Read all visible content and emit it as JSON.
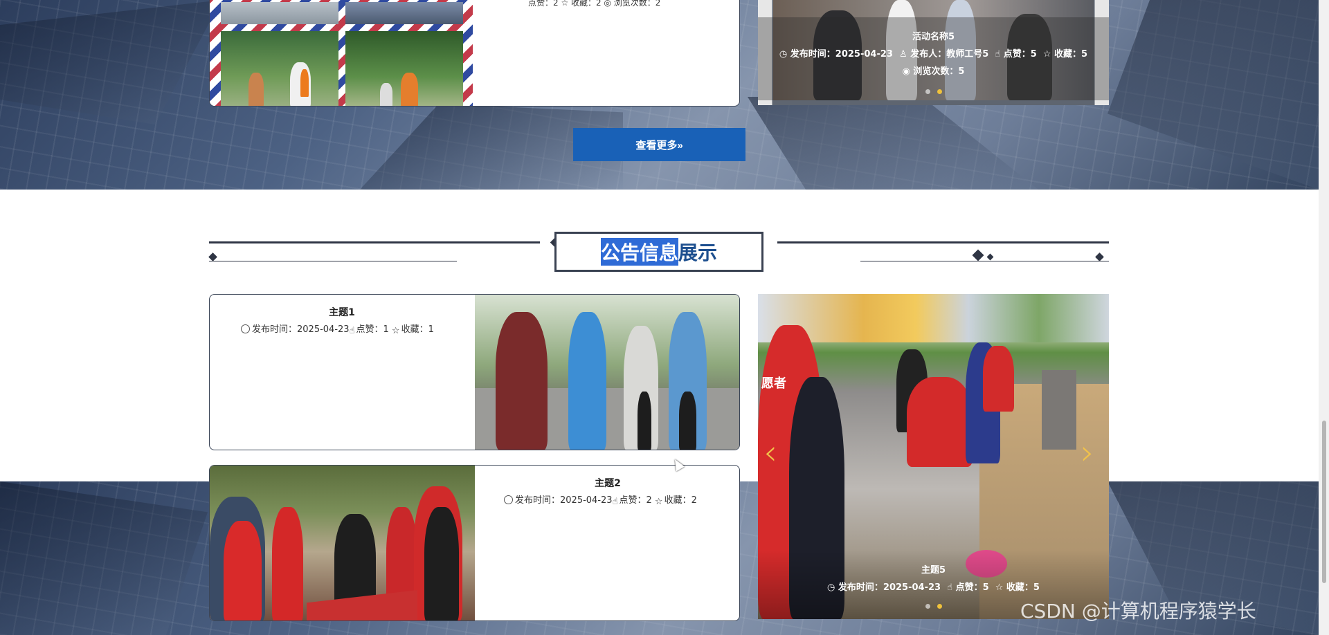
{
  "activity_section": {
    "card_top_meta_partial": "点赞：2 ☆ 收藏：2 ◎ 浏览次数：2",
    "carousel": {
      "title": "活动名称5",
      "meta_line1": "发布时间：2025-04-23",
      "publisher": "发布人：教师工号5",
      "likes": "点赞：5",
      "favorites": "收藏：5",
      "views": "浏览次数：5"
    },
    "more_button": "查看更多»"
  },
  "notice_section": {
    "heading_highlight": "公告信息",
    "heading_rest": "展示",
    "items": [
      {
        "title": "主题1",
        "time": "发布时间：2025-04-23",
        "likes": "点赞：1",
        "favorites": "收藏：1"
      },
      {
        "title": "主题2",
        "time": "发布时间：2025-04-23",
        "likes": "点赞：2",
        "favorites": "收藏：2"
      }
    ],
    "carousel": {
      "title": "主题5",
      "time": "发布时间：2025-04-23",
      "likes": "点赞：5",
      "favorites": "收藏：5",
      "sign_text": "愿者"
    }
  },
  "watermark": "CSDN @计算机程序猿学长",
  "colors": {
    "button": "#1961b7",
    "heading_highlight": "#2f6bd6",
    "heading_text": "#1d4f8f",
    "arrow": "#f1c24a"
  }
}
